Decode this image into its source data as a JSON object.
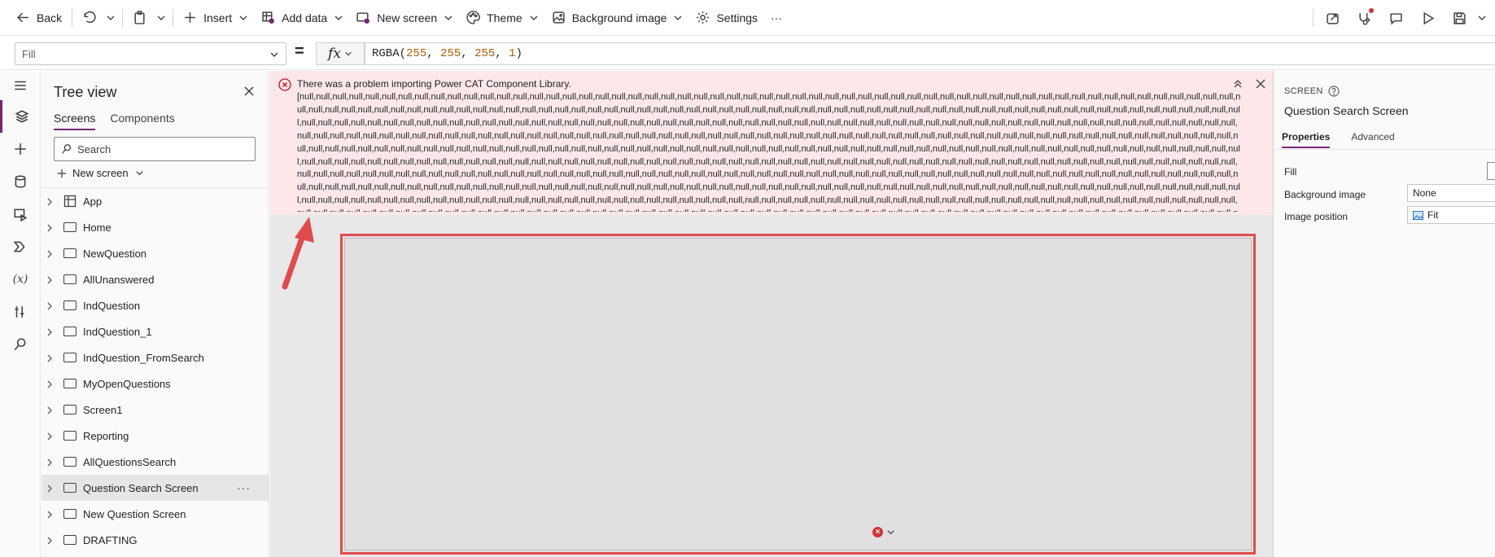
{
  "toolbar": {
    "back_label": "Back",
    "insert_label": "Insert",
    "add_data_label": "Add data",
    "new_screen_label": "New screen",
    "theme_label": "Theme",
    "background_image_label": "Background image",
    "settings_label": "Settings",
    "more_label": "···"
  },
  "formula_bar": {
    "property": "Fill",
    "equals": "=",
    "fx_label": "fx",
    "formula_fn": "RGBA(",
    "formula_args": [
      "255",
      "255",
      "255",
      "1"
    ],
    "formula_close": ")"
  },
  "tree_view": {
    "title": "Tree view",
    "tabs": [
      "Screens",
      "Components"
    ],
    "search_placeholder": "Search",
    "new_screen_label": "New screen",
    "items": [
      {
        "label": "App",
        "type": "app"
      },
      {
        "label": "Home",
        "type": "screen"
      },
      {
        "label": "NewQuestion",
        "type": "screen"
      },
      {
        "label": "AllUnanswered",
        "type": "screen"
      },
      {
        "label": "IndQuestion",
        "type": "screen"
      },
      {
        "label": "IndQuestion_1",
        "type": "screen"
      },
      {
        "label": "IndQuestion_FromSearch",
        "type": "screen"
      },
      {
        "label": "MyOpenQuestions",
        "type": "screen"
      },
      {
        "label": "Screen1",
        "type": "screen"
      },
      {
        "label": "Reporting",
        "type": "screen"
      },
      {
        "label": "AllQuestionsSearch",
        "type": "screen"
      },
      {
        "label": "Question Search Screen",
        "type": "screen",
        "selected": true
      },
      {
        "label": "New Question Screen",
        "type": "screen"
      },
      {
        "label": "DRAFTING",
        "type": "screen"
      }
    ],
    "item_more": "···"
  },
  "error_banner": {
    "title": "There was a problem importing Power CAT Component Library.",
    "body": "[null,null,null,null,null,null,null,null,null,null,null,null,null,null,null,null,null,null,null,null,null,null,null,null,null,null,null,null,null,null,null,null,null,null,null,null,null,null,null,null,null,null,null,null,null,null,null,null,null,null,null,null,null,null,null,null,null,null,null,null,null,null,null,null,null,null,null,null,null,null,null,null,null,null,null,null,null,null,null,null,null,null,null,null,null,null,null,null,null,null,null,null,null,null,null,null,null,null,null,null,null,null,null,null,null,null,null,null,null,null,null,null,null,null,null,null,null,null,null,null,null,null,null,null,null,null,null,null,null,null,null,null,null,null,null,null,null,null,null,null,null,null,null,null,null,null,null,null,null,null,null,null,null,null,null,null,null,null,null,null,null,null,null,null,null,null,null,null,null,null,null,null,null,null,null,null,null,null,null,null,null,null,null,null,null,null,null,null,null,null,null,null,null,null,null,null,null,null,null,null,null,null,null,null,null,null,null,null,null,null,null,null,null,null,null,null,null,null,null,null,null,null,null,null,null,null,null,null,null,null,null,null,null,null,null,null,null,null,null,null,null,null,null,null,null,null,null,null,null,null,null,null,null,null,null,null,null,null,null,null,null,null,null,null,null,null,null,null,null,null,null,null,null,null,null,null,null,null,null,null,null,null,null,null,null,null,null,null,null,null,null,null,null,null,null,null,null,null,null,null,null,null,null,null,null,null,null,null,null,null,null,null,null,null,null,null,null,null,null,null,null,null,null,null,null,null,null,null,null,null,null,null,null,null,null,null,null,null,null,null,null,null,null,null,null,null,null,null,null,null,null,null,null,null,null,null,null,null,null,null,null,null,null,null,null,null,null,null,null,null,null,null,null,null,null,null,null,null,null,null,null,null,null,null,null,null,null,null,null,null,null,null,null,null,null,null,null,null,null,null,null,null,null,null,null,null,null,null,null,null,null,null,null,null,null,null,null,null,null,null,null,null,null,null,null,null,null,null,null,null,null,null,null,null,null,null,null,null,null,null,null,null,null,null,null,null,null,null,null,null,null,null,null,null,null,null,null,null,null,null,null,null,null,null,null,null,null,null,null,null,null,null,null,null,null,null,null,null,null,null,null,null,null,null,null,null,null,null,null,null,null,null,null,null,null,null,null,null,null,null,null,null,null,null,null,null,null,null,null,null,null,null,null,null,null,null,null,null,null,null,null,null,null,null,null,null,null,null,null,null,null,null,null,null,null,null,null,null,null,null,null,null,null,null,null,null,null,null,null,null,null,null,null,null,null,null,null,null,null,null,null,null,null,null,null,null,null,null,null,null,null,null,null,null,null,null,null,null,null,null,null,null,null,null,null,null,null,null,null,null,null,null,null,null,null,null,null,null,null,null,null,null,null,null,null,null,null,null,null,[]]"
  },
  "properties_panel": {
    "type_label": "SCREEN",
    "name": "Question Search Screen",
    "tabs": [
      "Properties",
      "Advanced"
    ],
    "rows": [
      {
        "label": "Fill",
        "value": ""
      },
      {
        "label": "Background image",
        "value": "None"
      },
      {
        "label": "Image position",
        "value": "Fit"
      }
    ]
  },
  "colors": {
    "accent": "#742774",
    "error_bg": "#fde7e9",
    "error_icon": "#c50f1f",
    "annotation_red": "#e24b4b"
  }
}
